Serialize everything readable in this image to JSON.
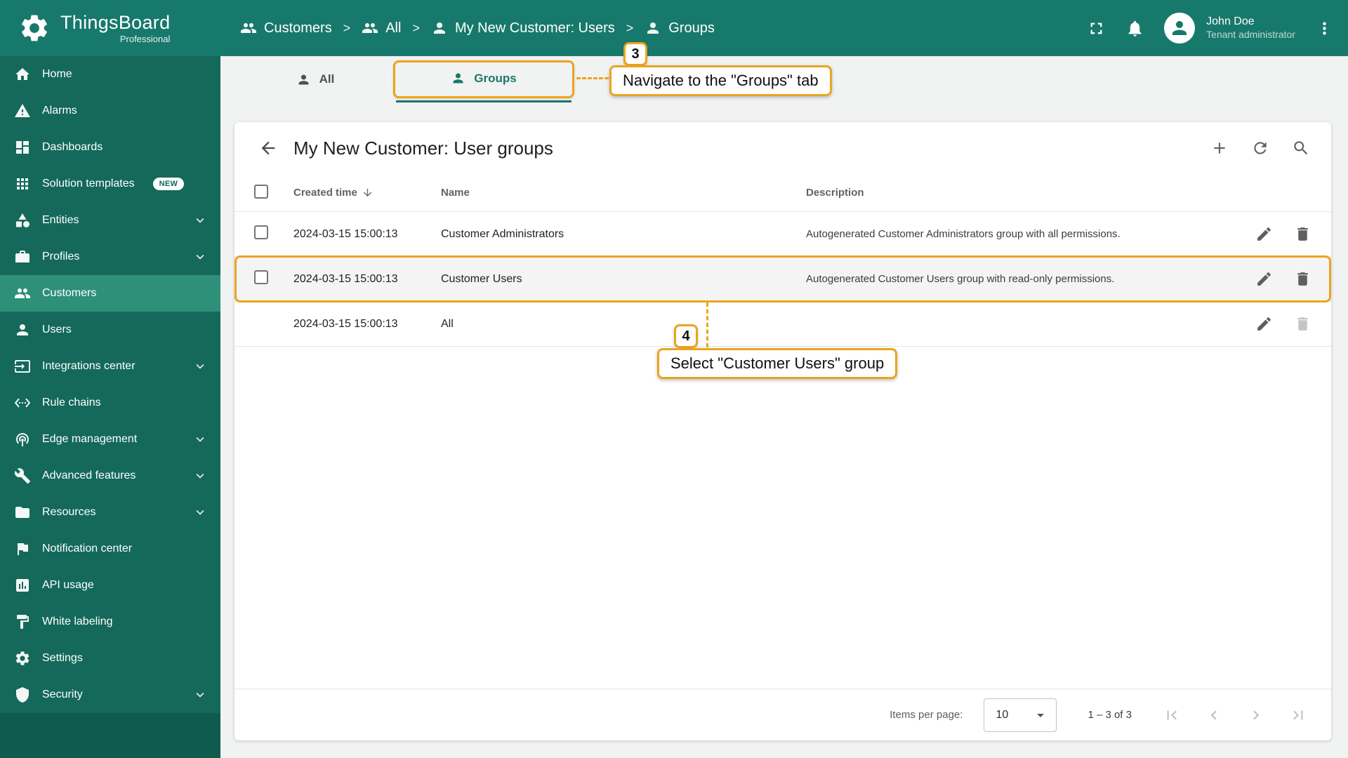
{
  "brand": {
    "name": "ThingsBoard",
    "edition": "Professional"
  },
  "header": {
    "separator": ">",
    "breadcrumb": [
      {
        "label": "Customers"
      },
      {
        "label": "All"
      },
      {
        "label": "My New Customer: Users"
      },
      {
        "label": "Groups"
      }
    ],
    "user": {
      "name": "John Doe",
      "role": "Tenant administrator"
    }
  },
  "sidebar": {
    "items": [
      {
        "label": "Home"
      },
      {
        "label": "Alarms"
      },
      {
        "label": "Dashboards"
      },
      {
        "label": "Solution templates",
        "badge": "NEW"
      },
      {
        "label": "Entities"
      },
      {
        "label": "Profiles"
      },
      {
        "label": "Customers"
      },
      {
        "label": "Users"
      },
      {
        "label": "Integrations center"
      },
      {
        "label": "Rule chains"
      },
      {
        "label": "Edge management"
      },
      {
        "label": "Advanced features"
      },
      {
        "label": "Resources"
      },
      {
        "label": "Notification center"
      },
      {
        "label": "API usage"
      },
      {
        "label": "White labeling"
      },
      {
        "label": "Settings"
      },
      {
        "label": "Security"
      }
    ]
  },
  "tabs": {
    "all": "All",
    "groups": "Groups"
  },
  "panel": {
    "title": "My New Customer: User groups",
    "columns": {
      "created": "Created time",
      "name": "Name",
      "description": "Description"
    },
    "rows": [
      {
        "created": "2024-03-15 15:00:13",
        "name": "Customer Administrators",
        "description": "Autogenerated Customer Administrators group with all permissions."
      },
      {
        "created": "2024-03-15 15:00:13",
        "name": "Customer Users",
        "description": "Autogenerated Customer Users group with read-only permissions."
      },
      {
        "created": "2024-03-15 15:00:13",
        "name": "All",
        "description": ""
      }
    ]
  },
  "pagination": {
    "items_per_page_label": "Items per page:",
    "items_per_page": "10",
    "range": "1 – 3 of 3"
  },
  "annotations": {
    "step3": {
      "number": "3",
      "text": "Navigate to the \"Groups\" tab"
    },
    "step4": {
      "number": "4",
      "text": "Select \"Customer Users\" group"
    }
  },
  "colors": {
    "primary": "#17796b",
    "sidebar": "#14695b",
    "active_nav": "#2e9078",
    "annotation": "#eca41f"
  }
}
